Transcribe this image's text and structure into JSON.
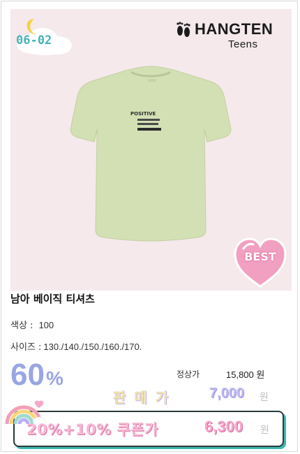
{
  "badge": {
    "date": "06-02"
  },
  "brand": {
    "name": "HANGTEN",
    "sub": "Teens"
  },
  "product_image": {
    "print_text": "POSITIVE",
    "best_badge": "BEST"
  },
  "product": {
    "title": "남아 베이직 티셔츠",
    "color_label": "색상 :",
    "color_value": "100",
    "size_label": "사이즈 :",
    "size_value": "130./140./150./160./170."
  },
  "pricing": {
    "discount_number": "60",
    "discount_symbol": "%",
    "regular_label": "정상가",
    "regular_price": "15,800 원",
    "sale_label": "판매가",
    "sale_price": "7,000",
    "sale_won": "원",
    "coupon_label": "20%+10% 쿠폰가",
    "coupon_price": "6,300",
    "coupon_won": "원"
  },
  "colors": {
    "photo_bg": "#f5e9ec",
    "shirt": "#d3e0b4",
    "discount": "#9aa5e3",
    "coupon_pink": "#f5a7ca",
    "accent_teal": "#3fb7b1"
  }
}
